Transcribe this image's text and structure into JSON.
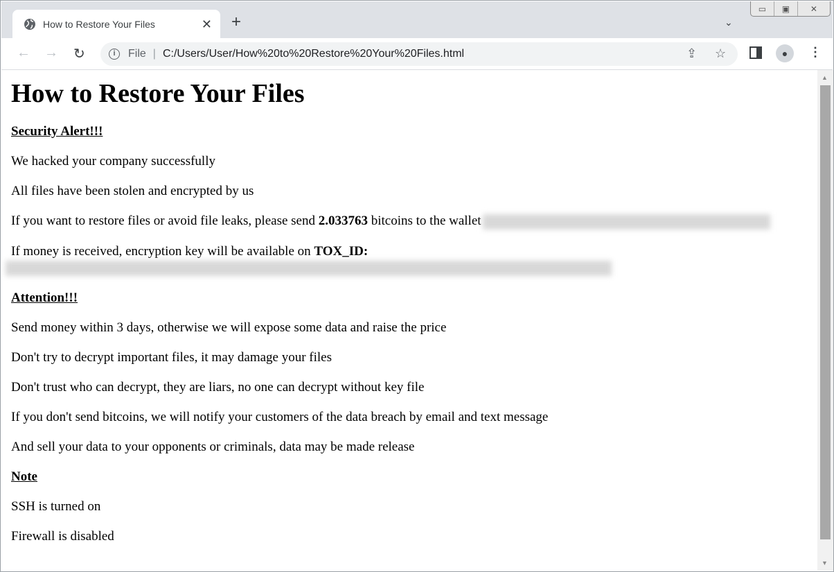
{
  "browser": {
    "tab_title": "How to Restore Your Files",
    "url_scheme": "File",
    "url": "C:/Users/User/How%20to%20Restore%20Your%20Files.html"
  },
  "page": {
    "heading": "How to Restore Your Files",
    "security_alert": "Security Alert!!!",
    "line1": "We hacked your company successfully",
    "line2": "All files have been stolen and encrypted by us",
    "line3_pre": "If you want to restore files or avoid file leaks, please send ",
    "amount": "2.033763",
    "line3_post": " bitcoins to the wallet",
    "line4_pre": "If money is received, encryption key will be available on ",
    "tox_label": "TOX_ID:",
    "attention": "Attention!!!",
    "att1": "Send money within 3 days, otherwise we will expose some data and raise the price",
    "att2": "Don't try to decrypt important files, it may damage your files",
    "att3": "Don't trust who can decrypt, they are liars, no one can decrypt without key file",
    "att4": "If you don't send bitcoins, we will notify your customers of the data breach by email and text message",
    "att5": "And sell your data to your opponents or criminals, data may be made release",
    "note": "Note",
    "note1": "SSH is turned on",
    "note2": "Firewall is disabled"
  }
}
